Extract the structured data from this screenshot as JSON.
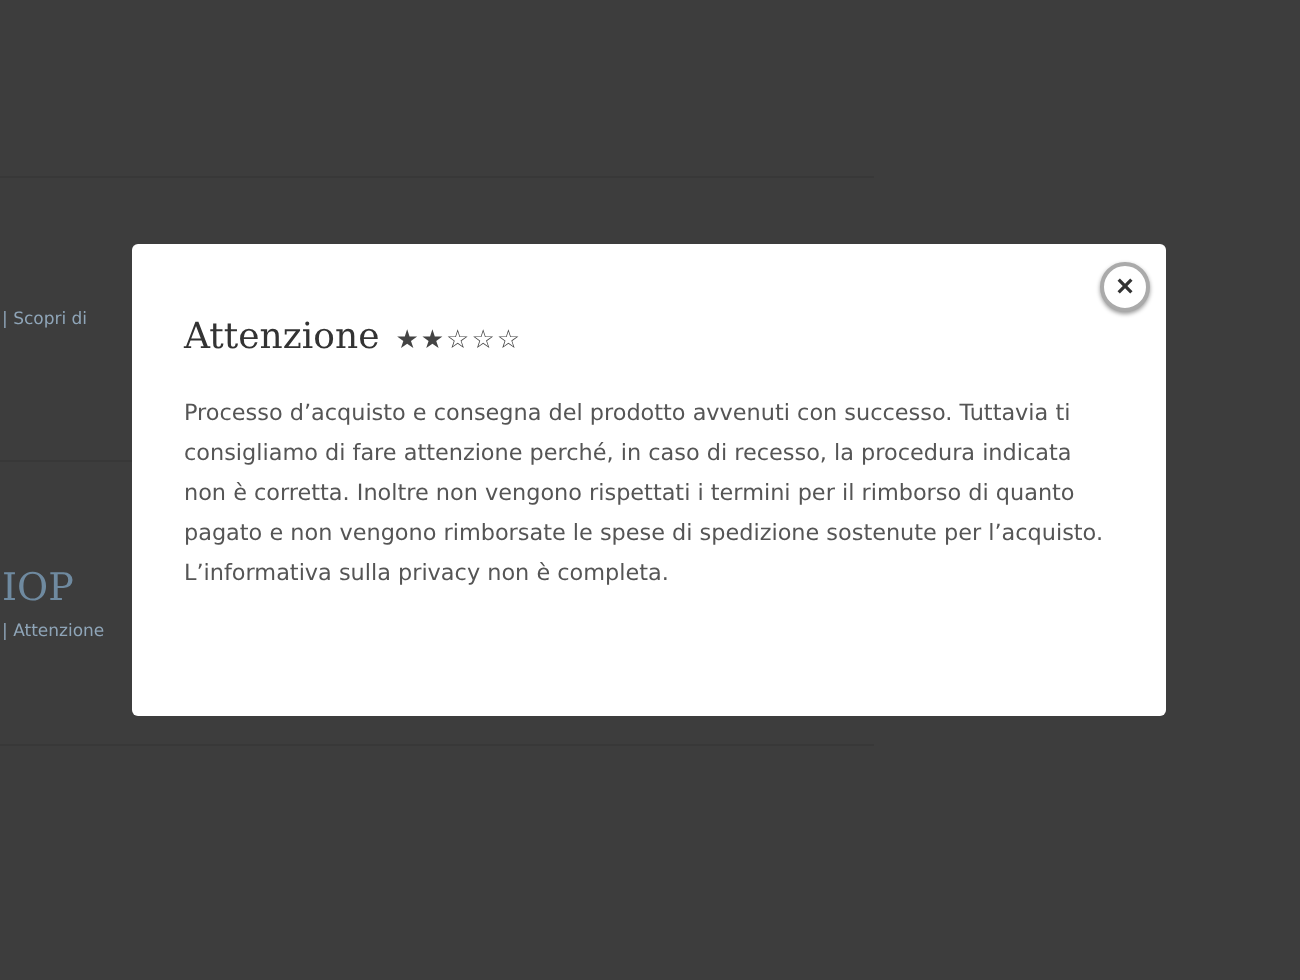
{
  "background": {
    "items": [
      {
        "meta": "| Scopri di"
      },
      {
        "title": "IOP",
        "meta": "| Attenzione"
      }
    ]
  },
  "modal": {
    "title": "Attenzione",
    "stars": 2,
    "close": "×",
    "body": "Processo d’acquisto e consegna del prodotto avvenuti con successo. Tuttavia ti consigliamo di fare attenzione perché, in caso di recesso, la procedura indicata non è corretta. Inoltre non vengono rispettati i termini per il rimborso di quanto pagato e non vengono rimborsate le spese di spedizione sostenute per l’acquisto. L’informativa sulla privacy non è completa."
  }
}
